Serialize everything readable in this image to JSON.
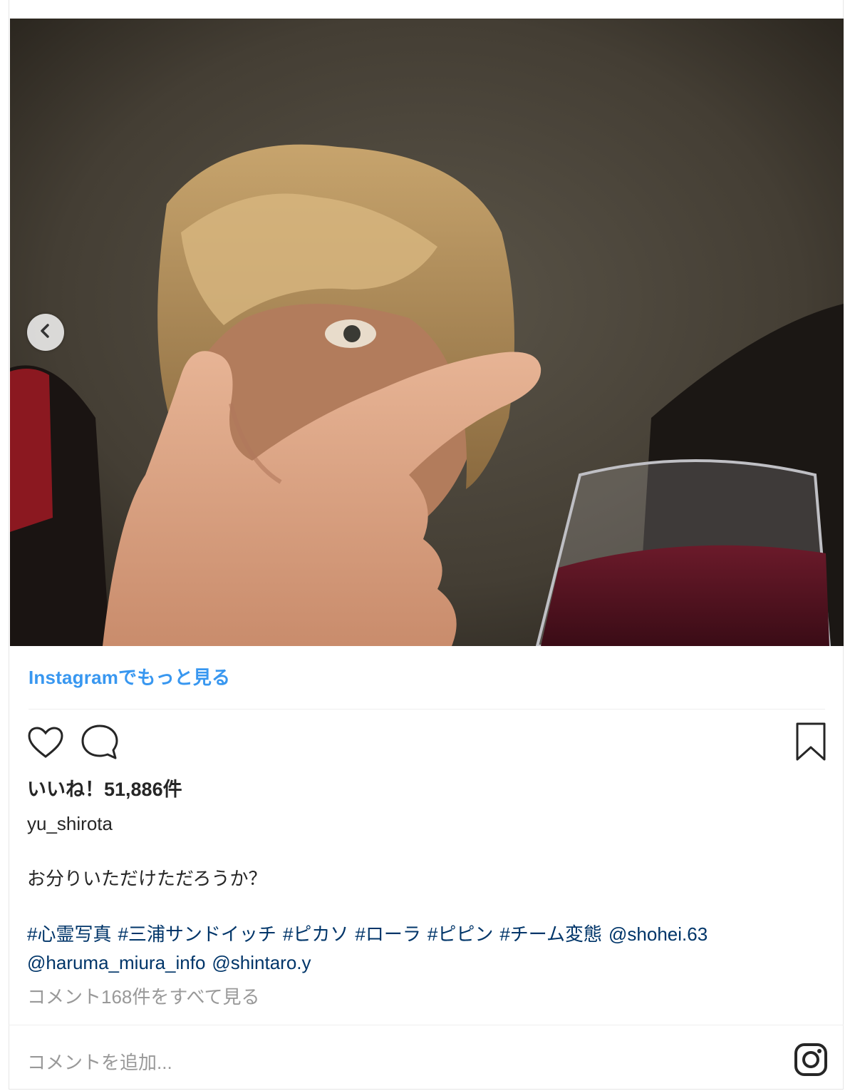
{
  "post": {
    "more_link": "Instagramでもっと見る",
    "likes_text": "いいね！51,886件",
    "username": "yu_shirota",
    "caption": "お分りいただけただろうか？",
    "tags": [
      "#心霊写真",
      "#三浦サンドイッチ",
      "#ピカソ",
      "#ローラ",
      "#ピピン",
      "#チーム変態",
      "@shohei.63",
      "@haruma_miura_info",
      "@shintaro.y"
    ],
    "view_comments": "コメント168件をすべて見る",
    "comment_placeholder": "コメントを追加..."
  },
  "icons": {
    "prev": "chevron-left-icon",
    "like": "heart-icon",
    "comment": "comment-bubble-icon",
    "save": "bookmark-icon",
    "instagram": "instagram-logo-icon"
  },
  "colors": {
    "link": "#3897f0",
    "hashtag": "#003569",
    "muted": "#999999",
    "text": "#262626"
  }
}
